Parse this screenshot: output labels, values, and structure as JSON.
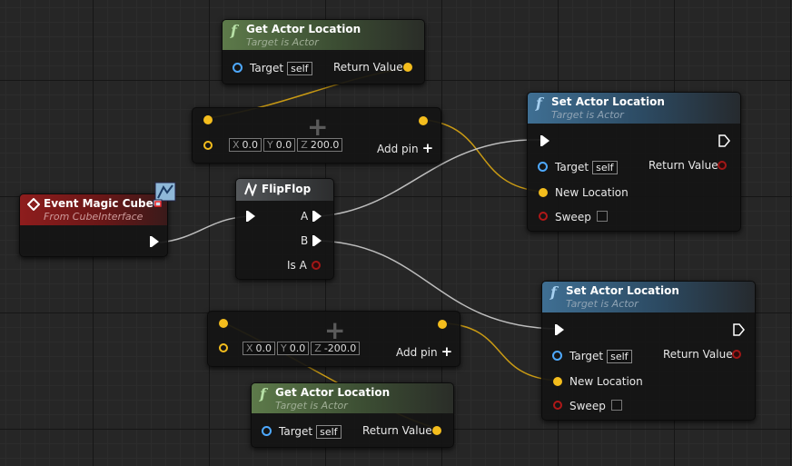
{
  "nodes": {
    "get_loc_top": {
      "title": "Get Actor Location",
      "subtitle": "Target is Actor",
      "target_label": "Target",
      "target_default": "self",
      "return_label": "Return Value"
    },
    "make_vec_top": {
      "x_label": "X",
      "x": "0.0",
      "y_label": "Y",
      "y": "0.0",
      "z_label": "Z",
      "z": "200.0",
      "add_pin": "Add pin"
    },
    "set_loc_top": {
      "title": "Set Actor Location",
      "subtitle": "Target is Actor",
      "target_label": "Target",
      "target_default": "self",
      "return_label": "Return Value",
      "new_location": "New Location",
      "sweep": "Sweep"
    },
    "event": {
      "title": "Event Magic Cube",
      "subtitle": "From CubeInterface"
    },
    "flipflop": {
      "title": "FlipFlop",
      "a": "A",
      "b": "B",
      "is_a": "Is A"
    },
    "set_loc_bottom": {
      "title": "Set Actor Location",
      "subtitle": "Target is Actor",
      "target_label": "Target",
      "target_default": "self",
      "return_label": "Return Value",
      "new_location": "New Location",
      "sweep": "Sweep"
    },
    "make_vec_bottom": {
      "x_label": "X",
      "x": "0.0",
      "y_label": "Y",
      "y": "0.0",
      "z_label": "Z",
      "z": "-200.0",
      "add_pin": "Add pin"
    },
    "get_loc_bottom": {
      "title": "Get Actor Location",
      "subtitle": "Target is Actor",
      "target_label": "Target",
      "target_default": "self",
      "return_label": "Return Value"
    }
  },
  "colors": {
    "exec": "#ffffff",
    "vector_pin": "#f4bd1d",
    "object_pin": "#4ea9ff",
    "bool_pin": "#b01818",
    "function_header": "#5d7a4a",
    "event_header": "#8e1d1d"
  }
}
